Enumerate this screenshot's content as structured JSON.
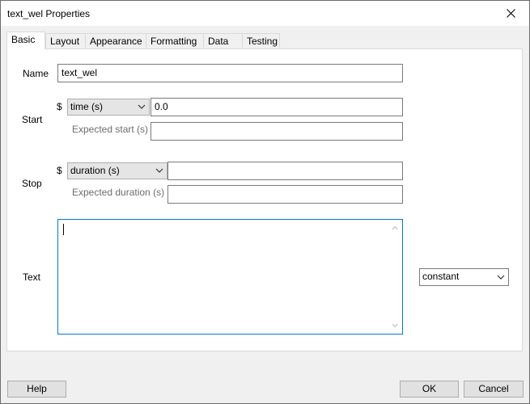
{
  "window": {
    "title": "text_wel Properties"
  },
  "tabs": [
    {
      "label": "Basic"
    },
    {
      "label": "Layout"
    },
    {
      "label": "Appearance"
    },
    {
      "label": "Formatting"
    },
    {
      "label": "Data"
    },
    {
      "label": "Testing"
    }
  ],
  "basic": {
    "name_label": "Name",
    "name_value": "text_wel",
    "start_label": "Start",
    "start_dollar": "$",
    "start_type": "time (s)",
    "start_value": "0.0",
    "expected_start_label": "Expected start (s)",
    "expected_start_value": "",
    "stop_label": "Stop",
    "stop_dollar": "$",
    "stop_type": "duration (s)",
    "stop_value": "",
    "expected_duration_label": "Expected duration (s)",
    "expected_duration_value": "",
    "text_label": "Text",
    "text_value": "",
    "text_update": "constant"
  },
  "buttons": {
    "help": "Help",
    "ok": "OK",
    "cancel": "Cancel"
  }
}
